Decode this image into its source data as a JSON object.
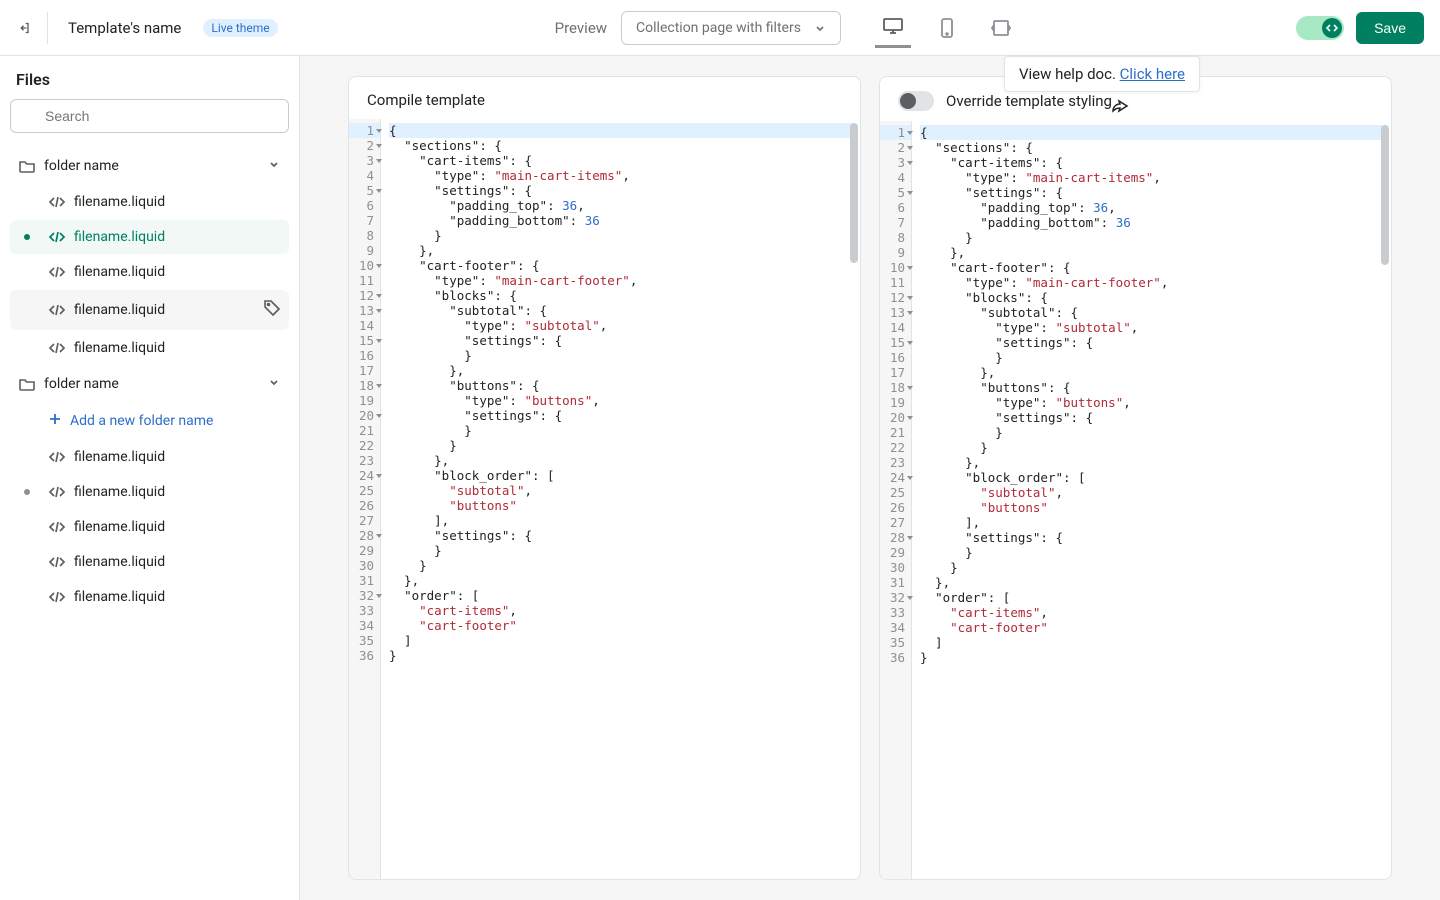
{
  "topbar": {
    "template_name": "Template's name",
    "live_badge": "Live theme",
    "preview_label": "Preview",
    "dropdown_value": "Collection page with filters",
    "save_label": "Save"
  },
  "tooltip": {
    "text": "View help doc. ",
    "link": "Click here"
  },
  "sidebar": {
    "title": "Files",
    "search_placeholder": "Search",
    "folders": [
      {
        "name": "folder name",
        "files": [
          {
            "name": "filename.liquid",
            "selected": false
          },
          {
            "name": "filename.liquid",
            "selected": true,
            "dot": "green"
          },
          {
            "name": "filename.liquid",
            "selected": false
          },
          {
            "name": "filename.liquid",
            "selected": false,
            "hover": true,
            "tag_icon": true
          },
          {
            "name": "filename.liquid",
            "selected": false
          }
        ]
      },
      {
        "name": "folder name",
        "add_label": "Add a new folder name",
        "files": [
          {
            "name": "filename.liquid",
            "selected": false
          },
          {
            "name": "filename.liquid",
            "selected": false,
            "dot": "grey"
          },
          {
            "name": "filename.liquid",
            "selected": false
          },
          {
            "name": "filename.liquid",
            "selected": false
          },
          {
            "name": "filename.liquid",
            "selected": false
          }
        ]
      }
    ]
  },
  "panes": {
    "left_title": "Compile template",
    "right_title": "Override template styling"
  },
  "code_lines": [
    {
      "n": 1,
      "fold": true,
      "active": true,
      "tokens": [
        [
          "punc",
          "{"
        ]
      ]
    },
    {
      "n": 2,
      "fold": true,
      "tokens": [
        [
          "punc",
          "  "
        ],
        [
          "key",
          "\"sections\""
        ],
        [
          "punc",
          ": {"
        ]
      ]
    },
    {
      "n": 3,
      "fold": true,
      "tokens": [
        [
          "punc",
          "    "
        ],
        [
          "key",
          "\"cart-items\""
        ],
        [
          "punc",
          ": {"
        ]
      ]
    },
    {
      "n": 4,
      "tokens": [
        [
          "punc",
          "      "
        ],
        [
          "key",
          "\"type\""
        ],
        [
          "punc",
          ": "
        ],
        [
          "str",
          "\"main-cart-items\""
        ],
        [
          "punc",
          ","
        ]
      ]
    },
    {
      "n": 5,
      "fold": true,
      "tokens": [
        [
          "punc",
          "      "
        ],
        [
          "key",
          "\"settings\""
        ],
        [
          "punc",
          ": {"
        ]
      ]
    },
    {
      "n": 6,
      "tokens": [
        [
          "punc",
          "        "
        ],
        [
          "key",
          "\"padding_top\""
        ],
        [
          "punc",
          ": "
        ],
        [
          "num",
          "36"
        ],
        [
          "punc",
          ","
        ]
      ]
    },
    {
      "n": 7,
      "tokens": [
        [
          "punc",
          "        "
        ],
        [
          "key",
          "\"padding_bottom\""
        ],
        [
          "punc",
          ": "
        ],
        [
          "num",
          "36"
        ]
      ]
    },
    {
      "n": 8,
      "tokens": [
        [
          "punc",
          "      }"
        ]
      ]
    },
    {
      "n": 9,
      "tokens": [
        [
          "punc",
          "    },"
        ]
      ]
    },
    {
      "n": 10,
      "fold": true,
      "tokens": [
        [
          "punc",
          "    "
        ],
        [
          "key",
          "\"cart-footer\""
        ],
        [
          "punc",
          ": {"
        ]
      ]
    },
    {
      "n": 11,
      "tokens": [
        [
          "punc",
          "      "
        ],
        [
          "key",
          "\"type\""
        ],
        [
          "punc",
          ": "
        ],
        [
          "str",
          "\"main-cart-footer\""
        ],
        [
          "punc",
          ","
        ]
      ]
    },
    {
      "n": 12,
      "fold": true,
      "tokens": [
        [
          "punc",
          "      "
        ],
        [
          "key",
          "\"blocks\""
        ],
        [
          "punc",
          ": {"
        ]
      ]
    },
    {
      "n": 13,
      "fold": true,
      "tokens": [
        [
          "punc",
          "        "
        ],
        [
          "key",
          "\"subtotal\""
        ],
        [
          "punc",
          ": {"
        ]
      ]
    },
    {
      "n": 14,
      "tokens": [
        [
          "punc",
          "          "
        ],
        [
          "key",
          "\"type\""
        ],
        [
          "punc",
          ": "
        ],
        [
          "str",
          "\"subtotal\""
        ],
        [
          "punc",
          ","
        ]
      ]
    },
    {
      "n": 15,
      "fold": true,
      "tokens": [
        [
          "punc",
          "          "
        ],
        [
          "key",
          "\"settings\""
        ],
        [
          "punc",
          ": {"
        ]
      ]
    },
    {
      "n": 16,
      "tokens": [
        [
          "punc",
          "          }"
        ]
      ]
    },
    {
      "n": 17,
      "tokens": [
        [
          "punc",
          "        },"
        ]
      ]
    },
    {
      "n": 18,
      "fold": true,
      "tokens": [
        [
          "punc",
          "        "
        ],
        [
          "key",
          "\"buttons\""
        ],
        [
          "punc",
          ": {"
        ]
      ]
    },
    {
      "n": 19,
      "tokens": [
        [
          "punc",
          "          "
        ],
        [
          "key",
          "\"type\""
        ],
        [
          "punc",
          ": "
        ],
        [
          "str",
          "\"buttons\""
        ],
        [
          "punc",
          ","
        ]
      ]
    },
    {
      "n": 20,
      "fold": true,
      "tokens": [
        [
          "punc",
          "          "
        ],
        [
          "key",
          "\"settings\""
        ],
        [
          "punc",
          ": {"
        ]
      ]
    },
    {
      "n": 21,
      "tokens": [
        [
          "punc",
          "          }"
        ]
      ]
    },
    {
      "n": 22,
      "tokens": [
        [
          "punc",
          "        }"
        ]
      ]
    },
    {
      "n": 23,
      "tokens": [
        [
          "punc",
          "      },"
        ]
      ]
    },
    {
      "n": 24,
      "fold": true,
      "tokens": [
        [
          "punc",
          "      "
        ],
        [
          "key",
          "\"block_order\""
        ],
        [
          "punc",
          ": ["
        ]
      ]
    },
    {
      "n": 25,
      "tokens": [
        [
          "punc",
          "        "
        ],
        [
          "str",
          "\"subtotal\""
        ],
        [
          "punc",
          ","
        ]
      ]
    },
    {
      "n": 26,
      "tokens": [
        [
          "punc",
          "        "
        ],
        [
          "str",
          "\"buttons\""
        ]
      ]
    },
    {
      "n": 27,
      "tokens": [
        [
          "punc",
          "      ],"
        ]
      ]
    },
    {
      "n": 28,
      "fold": true,
      "tokens": [
        [
          "punc",
          "      "
        ],
        [
          "key",
          "\"settings\""
        ],
        [
          "punc",
          ": {"
        ]
      ]
    },
    {
      "n": 29,
      "tokens": [
        [
          "punc",
          "      }"
        ]
      ]
    },
    {
      "n": 30,
      "tokens": [
        [
          "punc",
          "    }"
        ]
      ]
    },
    {
      "n": 31,
      "tokens": [
        [
          "punc",
          "  },"
        ]
      ]
    },
    {
      "n": 32,
      "fold": true,
      "tokens": [
        [
          "punc",
          "  "
        ],
        [
          "key",
          "\"order\""
        ],
        [
          "punc",
          ": ["
        ]
      ]
    },
    {
      "n": 33,
      "tokens": [
        [
          "punc",
          "    "
        ],
        [
          "str",
          "\"cart-items\""
        ],
        [
          "punc",
          ","
        ]
      ]
    },
    {
      "n": 34,
      "tokens": [
        [
          "punc",
          "    "
        ],
        [
          "str",
          "\"cart-footer\""
        ]
      ]
    },
    {
      "n": 35,
      "tokens": [
        [
          "punc",
          "  ]"
        ]
      ]
    },
    {
      "n": 36,
      "tokens": [
        [
          "punc",
          "}"
        ]
      ]
    }
  ]
}
